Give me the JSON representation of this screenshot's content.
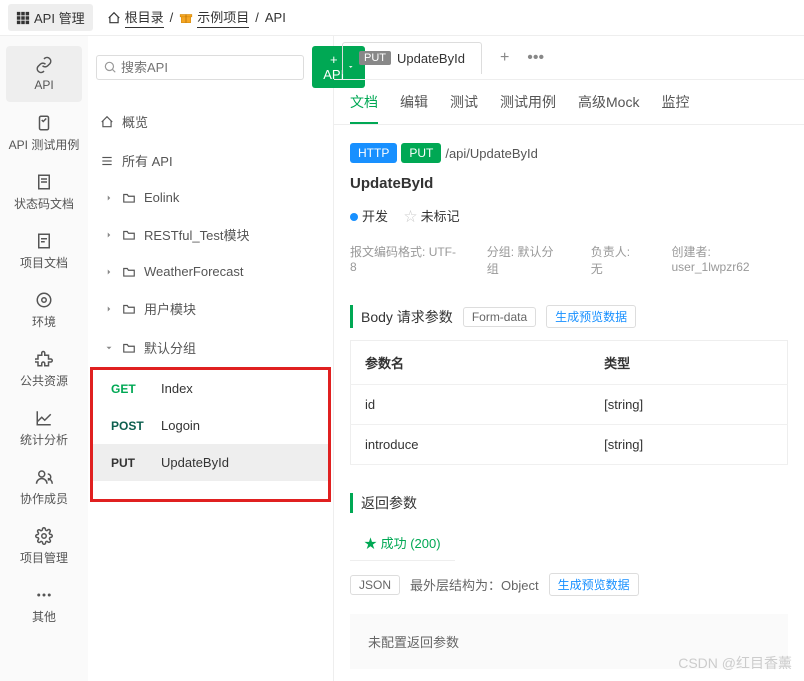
{
  "topbar": {
    "module": "API 管理",
    "breadcrumb": [
      "根目录",
      "示例项目",
      "API"
    ]
  },
  "sidebar": {
    "items": [
      {
        "label": "API",
        "icon": "link"
      },
      {
        "label": "API 测试用例",
        "icon": "test"
      },
      {
        "label": "状态码文档",
        "icon": "doc"
      },
      {
        "label": "项目文档",
        "icon": "page"
      },
      {
        "label": "环境",
        "icon": "env"
      },
      {
        "label": "公共资源",
        "icon": "puzzle"
      },
      {
        "label": "统计分析",
        "icon": "chart"
      },
      {
        "label": "协作成员",
        "icon": "users"
      },
      {
        "label": "项目管理",
        "icon": "gear"
      },
      {
        "label": "其他",
        "icon": "more"
      }
    ]
  },
  "tree": {
    "search_placeholder": "搜索API",
    "add_button": "+ API",
    "overview": "概览",
    "all_api": "所有 API",
    "folders": [
      {
        "label": "Eolink",
        "expanded": false
      },
      {
        "label": "RESTful_Test模块",
        "expanded": false
      },
      {
        "label": "WeatherForecast",
        "expanded": false
      },
      {
        "label": "用户模块",
        "expanded": false
      },
      {
        "label": "默认分组",
        "expanded": true
      }
    ],
    "apis": [
      {
        "method": "GET",
        "name": "Index"
      },
      {
        "method": "POST",
        "name": "Logoin"
      },
      {
        "method": "PUT",
        "name": "UpdateById",
        "selected": true
      }
    ]
  },
  "content": {
    "tab": {
      "method": "PUT",
      "name": "UpdateById"
    },
    "sub_tabs": [
      "文档",
      "编辑",
      "测试",
      "测试用例",
      "高级Mock",
      "监控"
    ],
    "active_sub_tab": 0,
    "protocol": "HTTP",
    "method": "PUT",
    "path": "/api/UpdateById",
    "title": "UpdateById",
    "dev_status": "开发",
    "tag_label": "未标记",
    "meta": {
      "encoding_label": "报文编码格式:",
      "encoding_value": "UTF-8",
      "group_label": "分组:",
      "group_value": "默认分组",
      "owner_label": "负责人:",
      "owner_value": "无",
      "creator_label": "创建者:",
      "creator_value": "user_1lwpzr62"
    },
    "body": {
      "title": "Body 请求参数",
      "type": "Form-data",
      "gen_preview": "生成预览数据",
      "cols": {
        "name": "参数名",
        "type": "类型"
      },
      "params": [
        {
          "name": "id",
          "type": "[string]"
        },
        {
          "name": "introduce",
          "type": "[string]"
        }
      ]
    },
    "response": {
      "title": "返回参数",
      "success_tab": "★ 成功 (200)",
      "format": "JSON",
      "struct_label": "最外层结构为：Object",
      "gen_preview": "生成预览数据",
      "empty": "未配置返回参数"
    }
  },
  "watermark": "CSDN @红目香薰"
}
